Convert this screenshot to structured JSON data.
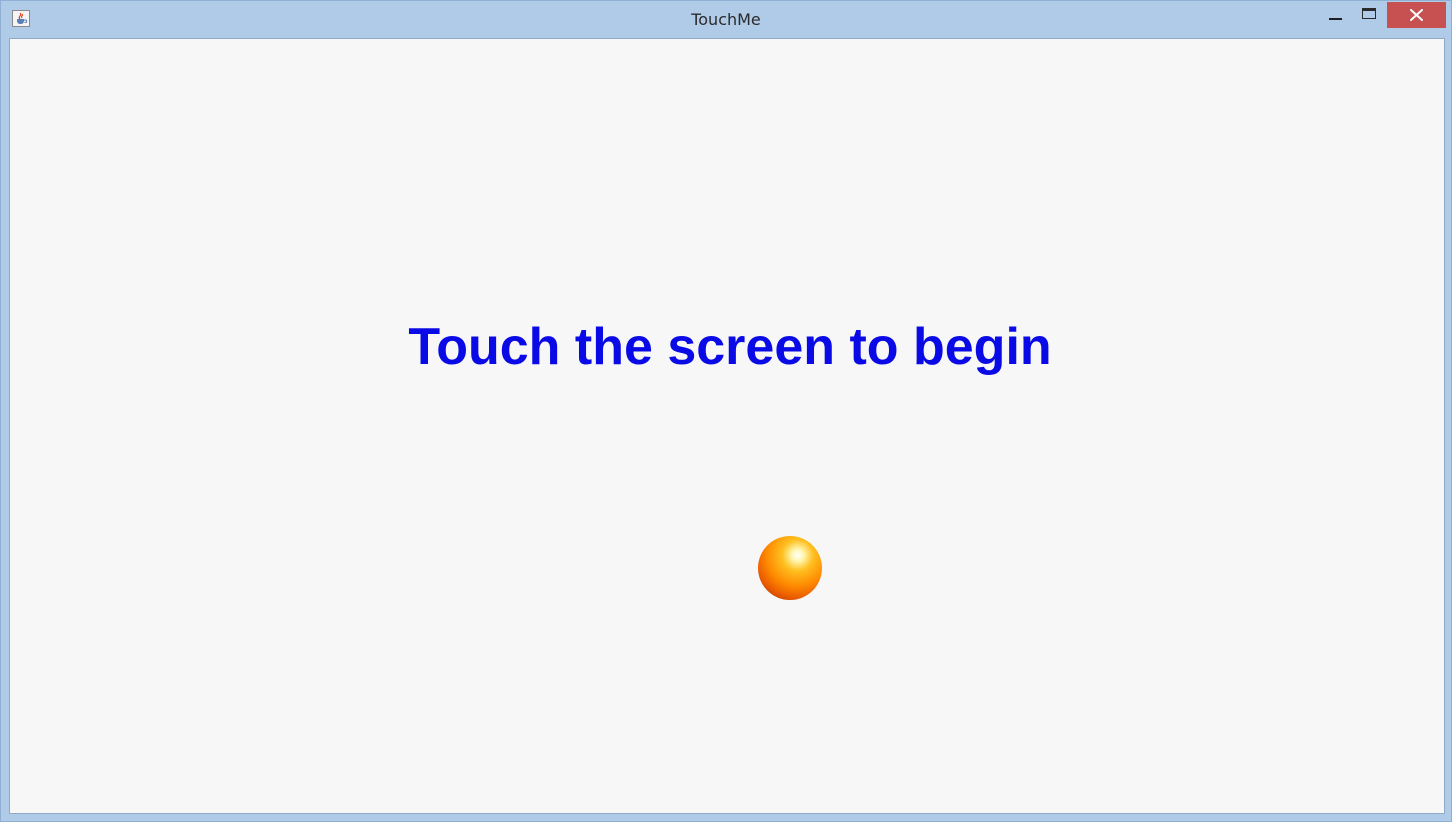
{
  "window": {
    "title": "TouchMe",
    "buttons": {
      "minimize": "minimize-icon",
      "maximize": "maximize-icon",
      "close": "close-icon"
    },
    "app_icon": "java-cup-icon",
    "colors": {
      "frame": "#afcbe8",
      "close_button": "#c75050",
      "client_background": "#f7f7f7"
    }
  },
  "game": {
    "prompt": "Touch the screen to begin",
    "prompt_color": "#0a0ae6",
    "ball": {
      "icon": "orange-ball-icon",
      "color": "#ff8a00"
    }
  }
}
